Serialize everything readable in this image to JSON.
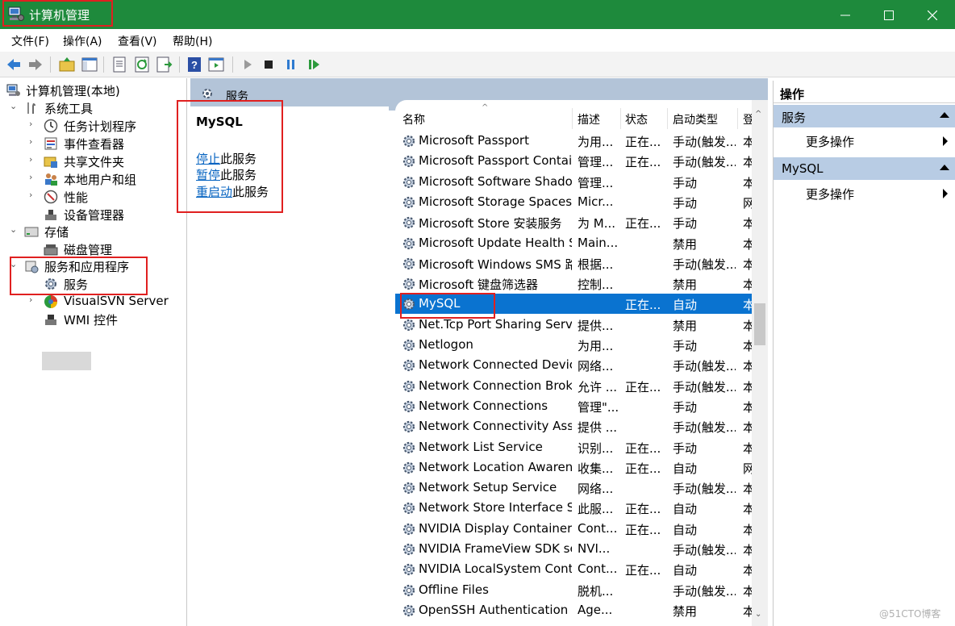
{
  "window": {
    "title": "计算机管理",
    "min_icon": "minimize-icon",
    "max_icon": "maximize-icon",
    "close_icon": "close-icon"
  },
  "menu": [
    "文件(F)",
    "操作(A)",
    "查看(V)",
    "帮助(H)"
  ],
  "toolbar": {
    "icons": [
      "back-icon",
      "forward-icon",
      "up-folder-icon",
      "show-hide-tree-icon",
      "properties-icon",
      "refresh-icon",
      "export-list-icon",
      "help-icon",
      "show-hide-action-icon",
      "start-service-icon",
      "stop-service-icon",
      "pause-service-icon",
      "restart-service-icon"
    ]
  },
  "tree": {
    "root": "计算机管理(本地)",
    "system_tools": "系统工具",
    "task_scheduler": "任务计划程序",
    "event_viewer": "事件查看器",
    "shared_folders": "共享文件夹",
    "local_users": "本地用户和组",
    "performance": "性能",
    "device_manager": "设备管理器",
    "storage": "存储",
    "disk_mgmt": "磁盘管理",
    "services_apps": "服务和应用程序",
    "services": "服务",
    "visualsvn": "VisualSVN Server",
    "wmi": "WMI 控件"
  },
  "middle": {
    "header": "服务",
    "selected_service": "MySQL",
    "actions": [
      {
        "link": "停止",
        "rest": "此服务"
      },
      {
        "link": "暂停",
        "rest": "此服务"
      },
      {
        "link": "重启动",
        "rest": "此服务"
      }
    ],
    "columns": {
      "name": "名称",
      "desc": "描述",
      "status": "状态",
      "startup": "启动类型",
      "login": "登"
    },
    "rows": [
      {
        "name": "Microsoft Passport",
        "desc": "为用...",
        "status": "正在...",
        "startup": "手动(触发...",
        "login": "本"
      },
      {
        "name": "Microsoft Passport Container",
        "desc": "管理...",
        "status": "正在...",
        "startup": "手动(触发...",
        "login": "本"
      },
      {
        "name": "Microsoft Software Shado...",
        "desc": "管理...",
        "status": "",
        "startup": "手动",
        "login": "本"
      },
      {
        "name": "Microsoft Storage Spaces S...",
        "desc": "Micr...",
        "status": "",
        "startup": "手动",
        "login": "网"
      },
      {
        "name": "Microsoft Store 安装服务",
        "desc": "为 M...",
        "status": "正在...",
        "startup": "手动",
        "login": "本"
      },
      {
        "name": "Microsoft Update Health S...",
        "desc": "Main...",
        "status": "",
        "startup": "禁用",
        "login": "本"
      },
      {
        "name": "Microsoft Windows SMS 路...",
        "desc": "根据...",
        "status": "",
        "startup": "手动(触发...",
        "login": "本"
      },
      {
        "name": "Microsoft 键盘筛选器",
        "desc": "控制...",
        "status": "",
        "startup": "禁用",
        "login": "本"
      },
      {
        "name": "MySQL",
        "desc": "",
        "status": "正在...",
        "startup": "自动",
        "login": "本"
      },
      {
        "name": "Net.Tcp Port Sharing Service",
        "desc": "提供...",
        "status": "",
        "startup": "禁用",
        "login": "本"
      },
      {
        "name": "Netlogon",
        "desc": "为用...",
        "status": "",
        "startup": "手动",
        "login": "本"
      },
      {
        "name": "Network Connected Devic...",
        "desc": "网络...",
        "status": "",
        "startup": "手动(触发...",
        "login": "本"
      },
      {
        "name": "Network Connection Broker",
        "desc": "允许 ...",
        "status": "正在...",
        "startup": "手动(触发...",
        "login": "本"
      },
      {
        "name": "Network Connections",
        "desc": "管理\"...",
        "status": "",
        "startup": "手动",
        "login": "本"
      },
      {
        "name": "Network Connectivity Assis...",
        "desc": "提供 ...",
        "status": "",
        "startup": "手动(触发...",
        "login": "本"
      },
      {
        "name": "Network List Service",
        "desc": "识别...",
        "status": "正在...",
        "startup": "手动",
        "login": "本"
      },
      {
        "name": "Network Location Awarene...",
        "desc": "收集...",
        "status": "正在...",
        "startup": "自动",
        "login": "网"
      },
      {
        "name": "Network Setup Service",
        "desc": "网络...",
        "status": "",
        "startup": "手动(触发...",
        "login": "本"
      },
      {
        "name": "Network Store Interface Se...",
        "desc": "此服...",
        "status": "正在...",
        "startup": "自动",
        "login": "本"
      },
      {
        "name": "NVIDIA Display Container LS",
        "desc": "Cont...",
        "status": "正在...",
        "startup": "自动",
        "login": "本"
      },
      {
        "name": "NVIDIA FrameView SDK se...",
        "desc": "NVI...",
        "status": "",
        "startup": "手动(触发...",
        "login": "本"
      },
      {
        "name": "NVIDIA LocalSystem Conta...",
        "desc": "Cont...",
        "status": "正在...",
        "startup": "自动",
        "login": "本"
      },
      {
        "name": "Offline Files",
        "desc": "脱机...",
        "status": "",
        "startup": "手动(触发...",
        "login": "本"
      },
      {
        "name": "OpenSSH Authentication ...",
        "desc": "Age...",
        "status": "",
        "startup": "禁用",
        "login": "本"
      }
    ]
  },
  "actions_pane": {
    "title": "操作",
    "section1": "服务",
    "more1": "更多操作",
    "section2": "MySQL",
    "more2": "更多操作"
  },
  "watermark": "@51CTO博客",
  "colors": {
    "titlebar": "#1e8a3c",
    "selection": "#0a73d0",
    "annotation": "#e02020"
  }
}
